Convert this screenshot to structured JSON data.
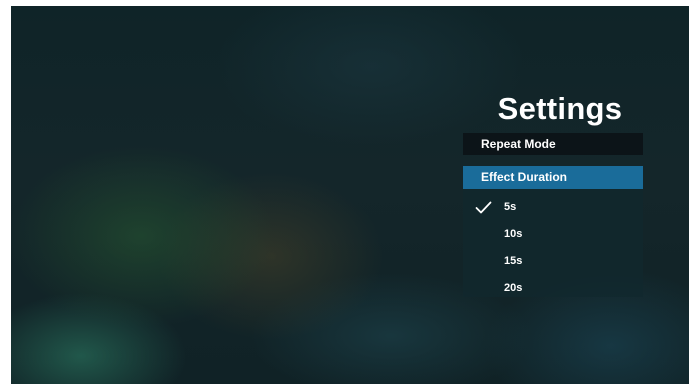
{
  "header": {
    "title": "Settings"
  },
  "menu": {
    "repeat_mode": "Repeat Mode",
    "effect_duration": "Effect Duration"
  },
  "effect_duration_options": [
    {
      "label": "5s",
      "selected": true
    },
    {
      "label": "10s",
      "selected": false
    },
    {
      "label": "15s",
      "selected": false
    },
    {
      "label": "20s",
      "selected": false
    }
  ],
  "colors": {
    "highlight": "#1a6c9a",
    "menu_background": "#0c1418",
    "text": "#ffffff"
  },
  "icons": {
    "selected_marker": "check-icon"
  }
}
